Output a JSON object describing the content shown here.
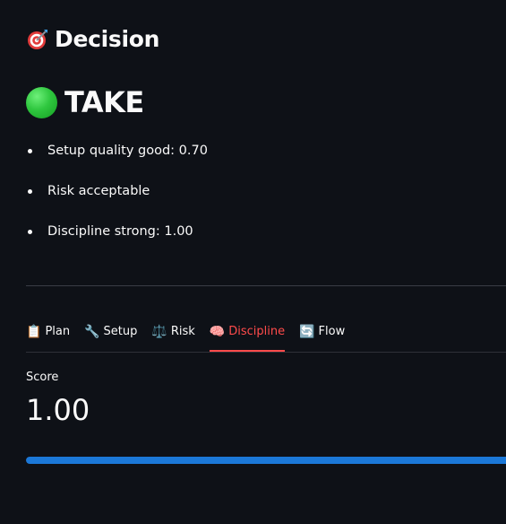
{
  "header": {
    "title": "Decision",
    "icon": "direct-hit-target-icon"
  },
  "verdict": {
    "label": "TAKE",
    "icon": "green-circle-icon",
    "color": "#2fc73f"
  },
  "reasons": [
    "Setup quality good: 0.70",
    "Risk acceptable",
    "Discipline strong: 1.00"
  ],
  "tabs": [
    {
      "label": "Plan",
      "icon": "clipboard-icon",
      "glyph": "📋",
      "active": false
    },
    {
      "label": "Setup",
      "icon": "wrench-icon",
      "glyph": "🔧",
      "active": false
    },
    {
      "label": "Risk",
      "icon": "balance-scale-icon",
      "glyph": "⚖️",
      "active": false
    },
    {
      "label": "Discipline",
      "icon": "brain-icon",
      "glyph": "🧠",
      "active": true
    },
    {
      "label": "Flow",
      "icon": "refresh-arrows-icon",
      "glyph": "🔄",
      "active": false
    }
  ],
  "metric": {
    "label": "Score",
    "value": "1.00"
  },
  "progress": {
    "fraction": 1.0,
    "color": "#1b78d8"
  },
  "theme": {
    "accent": "#ff4b4b",
    "background": "#0e1117"
  }
}
